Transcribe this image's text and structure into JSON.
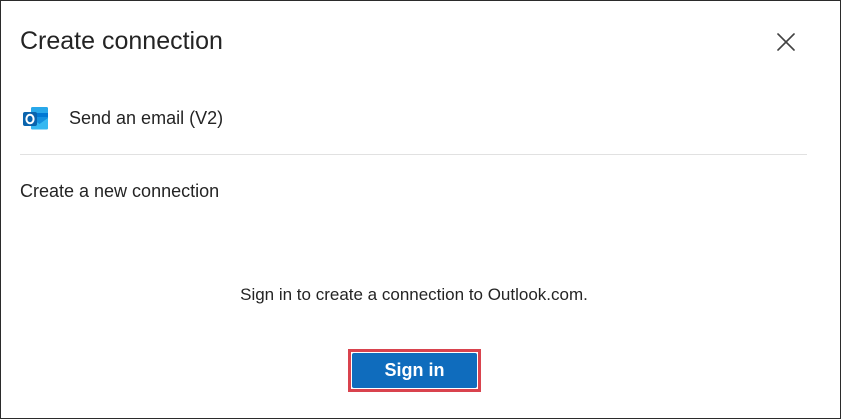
{
  "dialog": {
    "title": "Create connection",
    "close_icon": "close-icon"
  },
  "action": {
    "icon": "outlook-icon",
    "label": "Send an email (V2)"
  },
  "section": {
    "title": "Create a new connection",
    "description": "Sign in to create a connection to Outlook.com.",
    "signin_label": "Sign in"
  },
  "colors": {
    "primary_button": "#0f6cbd",
    "highlight_border": "#d9434e",
    "outlook_blue": "#0a64ad"
  }
}
